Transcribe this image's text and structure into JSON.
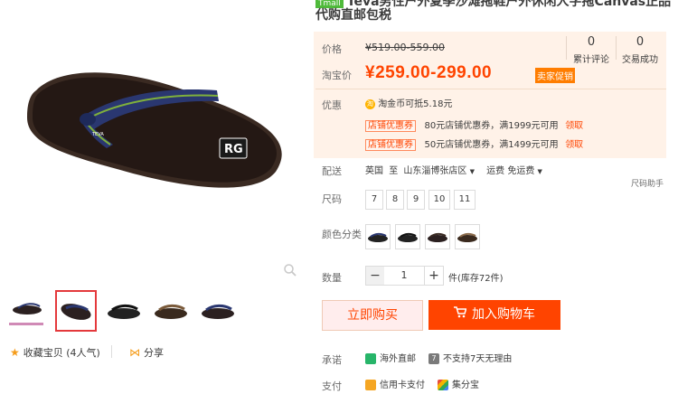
{
  "title": {
    "badge": "Tmall",
    "line1": "Teva男性户外夏季沙滩拖鞋户外休闲人字拖Canvas正品",
    "line2": "代购直邮包税"
  },
  "price": {
    "original_label": "价格",
    "original_price": "¥519.00-559.00",
    "taobao_label": "淘宝价",
    "taobao_price": "¥259.00-299.00",
    "promo_tag": "卖家促销",
    "reviews_count": "0",
    "reviews_label": "累计评论",
    "sales_count": "0",
    "sales_label": "交易成功"
  },
  "discount": {
    "label": "优惠",
    "coin_text": "淘金币可抵5.18元",
    "coupons": [
      {
        "tag": "店铺优惠券",
        "text": "80元店铺优惠券，满1999元可用",
        "action": "领取"
      },
      {
        "tag": "店铺优惠券",
        "text": "50元店铺优惠券，满1499元可用",
        "action": "领取"
      }
    ]
  },
  "shipping": {
    "label": "配送",
    "from": "英国",
    "to_word": "至",
    "destination": "山东淄博张店区",
    "fee": "运费 免运费",
    "size_helper": "尺码助手"
  },
  "sizes": {
    "label": "尺码",
    "options": [
      "7",
      "8",
      "9",
      "10",
      "11"
    ]
  },
  "colors": {
    "label": "颜色分类"
  },
  "quantity": {
    "label": "数量",
    "value": "1",
    "minus": "−",
    "plus": "+",
    "stock": "件(库存72件)"
  },
  "buttons": {
    "buy_now": "立即购买",
    "add_cart": "加入购物车"
  },
  "promise": {
    "label": "承诺",
    "item1": "海外直邮",
    "item2": "不支持7天无理由"
  },
  "payment": {
    "label": "支付",
    "item1": "信用卡支付",
    "item2": "集分宝"
  },
  "gallery": {
    "favorite": "收藏宝贝 (4人气)",
    "share": "分享"
  },
  "colors_palette": {
    "accent": "#ff4400",
    "panel_bg": "#fff2e8"
  }
}
